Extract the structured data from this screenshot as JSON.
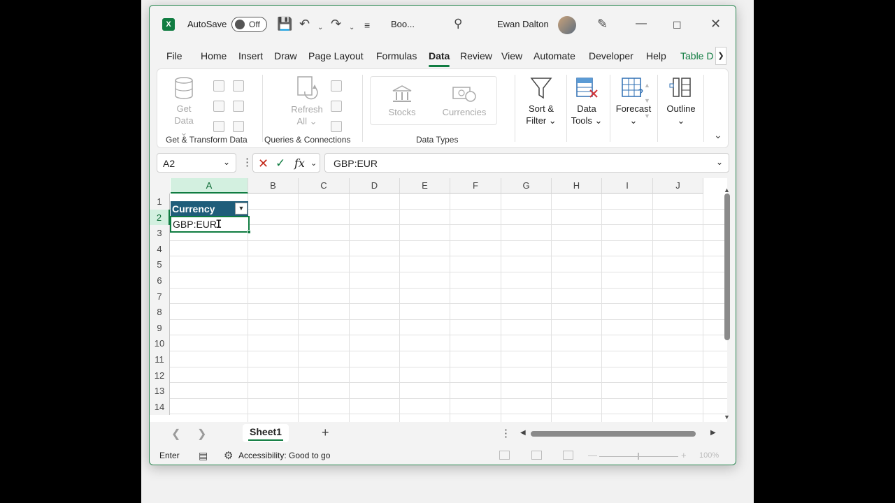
{
  "titlebar": {
    "app_icon": "excel-logo",
    "autosave_label": "AutoSave",
    "autosave_state": "Off",
    "doc_title": "Boo...",
    "user_name": "Ewan Dalton"
  },
  "tabs": [
    "File",
    "Home",
    "Insert",
    "Draw",
    "Page Layout",
    "Formulas",
    "Data",
    "Review",
    "View",
    "Automate",
    "Developer",
    "Help",
    "Table D"
  ],
  "active_tab": "Data",
  "ribbon": {
    "groups": {
      "get_transform": "Get & Transform Data",
      "queries": "Queries & Connections",
      "data_types": "Data Types"
    },
    "get_data": [
      "Get",
      "Data"
    ],
    "refresh_all": [
      "Refresh",
      "All"
    ],
    "stocks": "Stocks",
    "currencies": "Currencies",
    "sort_filter": [
      "Sort &",
      "Filter"
    ],
    "data_tools": [
      "Data",
      "Tools"
    ],
    "forecast": "Forecast",
    "outline": "Outline"
  },
  "formula_bar": {
    "name_box": "A2",
    "formula": "GBP:EUR"
  },
  "grid": {
    "columns": [
      "A",
      "B",
      "C",
      "D",
      "E",
      "F",
      "G",
      "H",
      "I",
      "J"
    ],
    "rows": [
      "1",
      "2",
      "3",
      "4",
      "5",
      "6",
      "7",
      "8",
      "9",
      "10",
      "11",
      "12",
      "13",
      "14"
    ],
    "header_cell": "Currency",
    "active_cell_value": "GBP:EUR",
    "selected_column": "A",
    "selected_row": "2"
  },
  "sheets": [
    "Sheet1"
  ],
  "status": {
    "mode": "Enter",
    "accessibility": "Accessibility: Good to go",
    "zoom": "100%"
  },
  "colors": {
    "accent": "#107c41",
    "table_header": "#1f5d7a"
  }
}
